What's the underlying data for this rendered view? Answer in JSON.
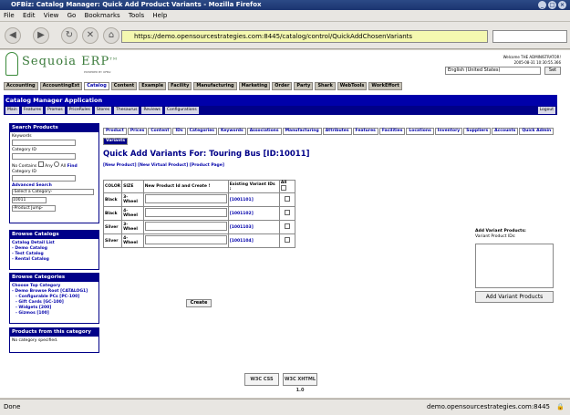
{
  "window": {
    "title": "OFBiz: Catalog Manager: Quick Add Product Variants - Mozilla Firefox"
  },
  "menu": [
    "File",
    "Edit",
    "View",
    "Go",
    "Bookmarks",
    "Tools",
    "Help"
  ],
  "browser": {
    "url": "https://demo.opensourcestrategies.com:8445/catalog/control/QuickAddChosenVariants",
    "status_left": "Done",
    "status_right": "demo.opensourcestrategies.com:8445"
  },
  "header": {
    "logo": "Sequoia ERP",
    "tm": "TM",
    "powered": "POWERED BY OFBiz",
    "welcome": "Welcome THE ADMINISTRATOR!",
    "datetime": "2005-08-31 10:30:55.366",
    "language": "English (United States)",
    "set_label": "Set"
  },
  "app_tabs": [
    "Accounting",
    "AccountingExt",
    "Catalog",
    "Content",
    "Example",
    "Facility",
    "Manufacturing",
    "Marketing",
    "Order",
    "Party",
    "Shark",
    "WebTools",
    "WorkEffort"
  ],
  "app_title": "Catalog Manager Application",
  "sub_tabs": [
    "Main",
    "Features",
    "Promos",
    "PriceRules",
    "Stores",
    "Thesaurus",
    "Reviews",
    "Configurations"
  ],
  "logout": "Logout",
  "search_box": {
    "title": "Search Products",
    "keywords_label": "Keywords",
    "category_label": "Category ID",
    "no_contains": "No Contains",
    "any": "Any",
    "all": "All",
    "find": "Find",
    "category_id_label": "Category ID",
    "advanced": "Advanced Search",
    "select_category": "-Select a Category-",
    "product_id": "10011",
    "product_jump": "-Product Jump-"
  },
  "browse_catalogs": {
    "title": "Browse Catalogs",
    "detail": "Catalog Detail List",
    "items": [
      "- Demo Catalog",
      "- Test Catalog",
      "- Rental Catalog"
    ]
  },
  "browse_categories": {
    "title": "Browse Categories",
    "choose": "Choose Top Category",
    "items": [
      "- Demo Browse Root [CATALOG1]",
      "- Configurable PCs [PC-100]",
      "- Gift Cards [GC-100]",
      "- Widgets [200]",
      "- Gizmos [100]"
    ]
  },
  "products_box": {
    "title": "Products from this category",
    "empty": "No category specified."
  },
  "product_tabs": [
    "Product",
    "Prices",
    "Content",
    "IDs",
    "Categories",
    "Keywords",
    "Associations",
    "Manufacturing",
    "Attributes",
    "Features",
    "Facilities",
    "Locations",
    "Inventory",
    "Suppliers",
    "Accounts",
    "Quick Admin",
    "Variants"
  ],
  "page_title": "Quick Add Variants For: Touring Bus [ID:10011]",
  "links": {
    "new_product": "[New Product]",
    "new_virtual": "[New Virtual Product]",
    "product_page": "[Product Page]"
  },
  "variant_table": {
    "headers": [
      "COLOR",
      "SIZE",
      "New Product Id and Create !",
      "Existing Variant IDs :",
      "All"
    ],
    "rows": [
      {
        "color": "Black",
        "size": "3-Wheel",
        "existing": "[1001101]"
      },
      {
        "color": "Black",
        "size": "4-Wheel",
        "existing": "[1001102]"
      },
      {
        "color": "Silver",
        "size": "3-Wheel",
        "existing": "[1001103]"
      },
      {
        "color": "Silver",
        "size": "4-Wheel",
        "existing": "[1001104]"
      }
    ],
    "create_label": "Create"
  },
  "add_variant": {
    "title": "Add Variant Products:",
    "subtitle": "Variant Product IDs:",
    "button": "Add Variant Products"
  },
  "badges": {
    "css": "W3C CSS",
    "xhtml": "W3C XHTML 1.0"
  }
}
